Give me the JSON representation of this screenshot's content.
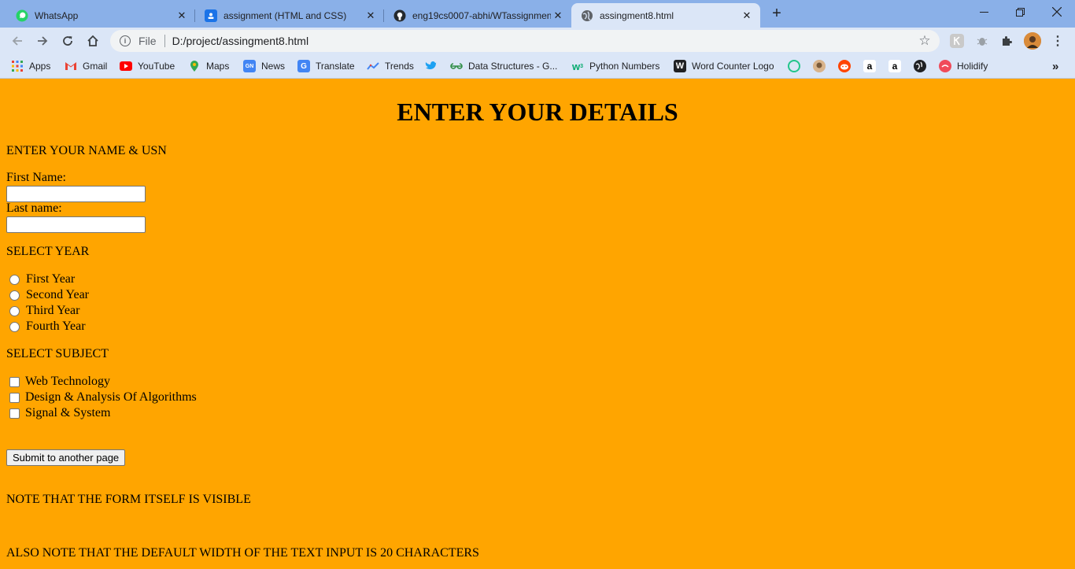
{
  "browser": {
    "tabs": [
      {
        "title": "WhatsApp",
        "icon": "whatsapp-icon",
        "color": "#25d366"
      },
      {
        "title": "assignment (HTML and CSS)",
        "icon": "classroom-icon",
        "color": "#1a73e8"
      },
      {
        "title": "eng19cs0007-abhi/WTassignmen",
        "icon": "github-icon",
        "color": "#24292e"
      },
      {
        "title": "assingment8.html",
        "icon": "globe-icon",
        "color": "#5f6368",
        "active": true
      }
    ],
    "address": {
      "scheme": "File",
      "url": "D:/project/assingment8.html"
    },
    "bookmarks": [
      {
        "label": "Apps",
        "icon": "apps-grid-icon"
      },
      {
        "label": "Gmail",
        "icon": "gmail-icon"
      },
      {
        "label": "YouTube",
        "icon": "youtube-icon"
      },
      {
        "label": "Maps",
        "icon": "maps-icon"
      },
      {
        "label": "News",
        "icon": "news-icon"
      },
      {
        "label": "Translate",
        "icon": "translate-icon"
      },
      {
        "label": "Trends",
        "icon": "trends-icon"
      },
      {
        "label": "",
        "icon": "twitter-icon"
      },
      {
        "label": "Data Structures - G...",
        "icon": "geeksforgeeks-icon"
      },
      {
        "label": "Python Numbers",
        "icon": "w3schools-icon"
      },
      {
        "label": "Word Counter Logo",
        "icon": "w-logo-icon"
      },
      {
        "label": "Holidify",
        "icon": "holidify-icon"
      }
    ],
    "more_bookmarks": "»"
  },
  "page": {
    "heading": "ENTER YOUR DETAILS",
    "name_section": "ENTER YOUR NAME & USN",
    "first_name_label": "First Name:",
    "first_name_value": "",
    "last_name_label": "Last name:",
    "last_name_value": "",
    "year_section": "SELECT YEAR",
    "years": [
      "First Year",
      "Second Year",
      "Third Year",
      "Fourth Year"
    ],
    "subject_section": "SELECT SUBJECT",
    "subjects": [
      "Web Technology",
      "Design & Analysis Of Algorithms",
      "Signal & System"
    ],
    "submit_label": "Submit to another page",
    "note1": "NOTE THAT THE FORM ITSELF IS VISIBLE",
    "note2": "ALSO NOTE THAT THE DEFAULT WIDTH OF THE TEXT INPUT IS 20 CHARACTERS"
  }
}
